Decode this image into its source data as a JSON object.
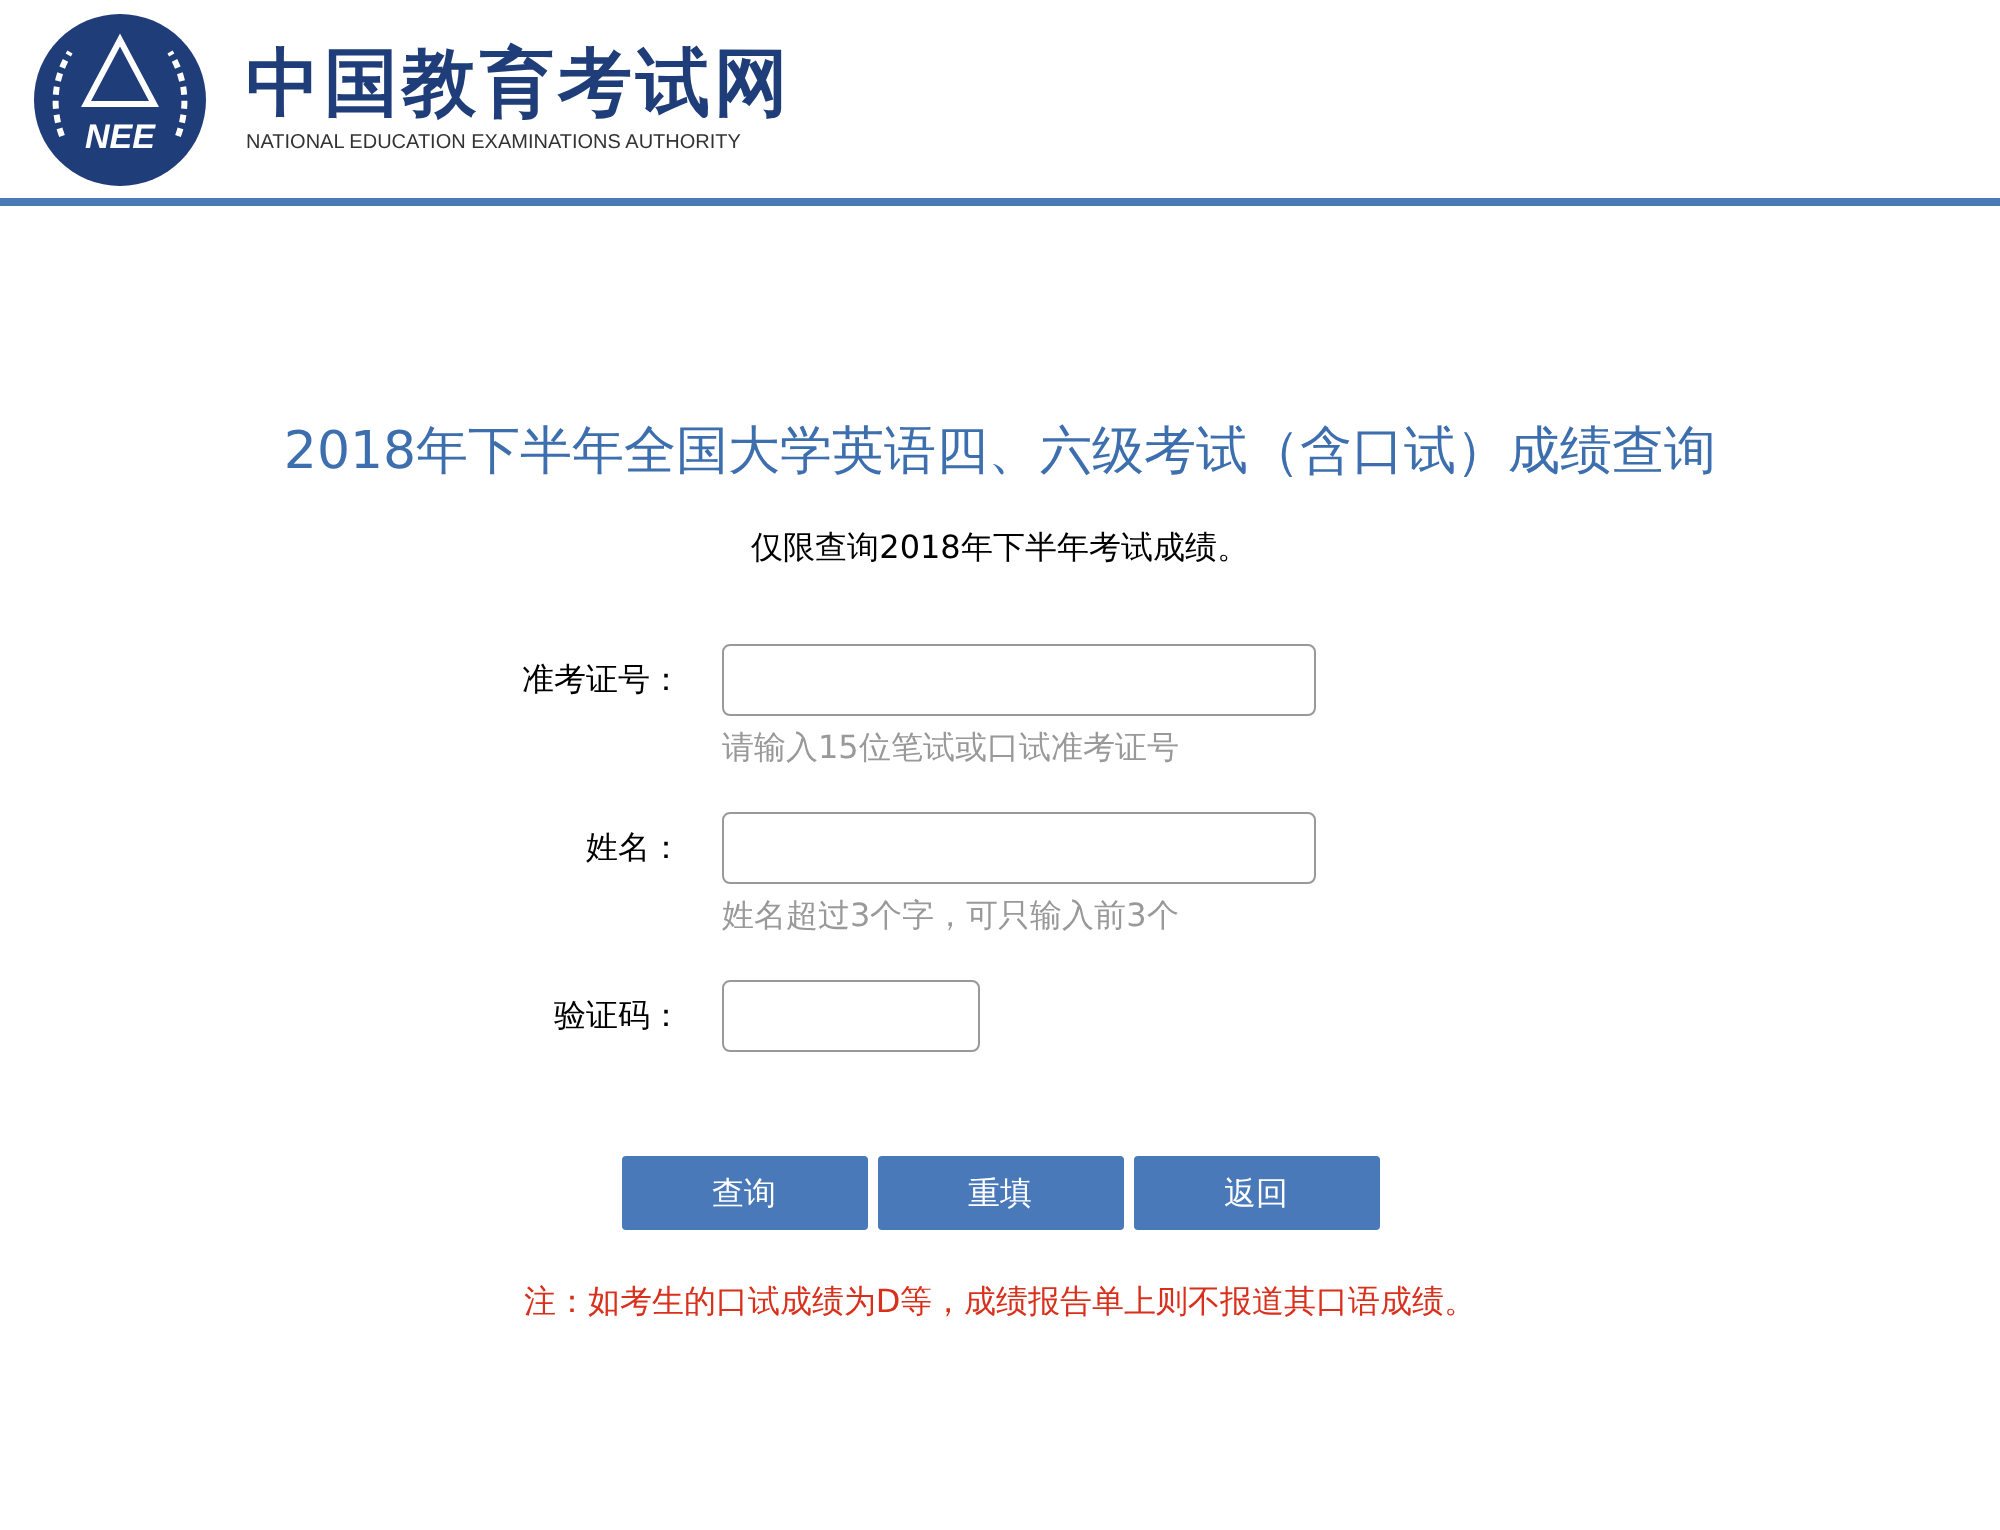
{
  "header": {
    "logo": {
      "emblem_text": "NEE",
      "name_cn": "中国教育考试网",
      "name_en": "NATIONAL EDUCATION EXAMINATIONS AUTHORITY"
    }
  },
  "title": "2018年下半年全国大学英语四、六级考试（含口试）成绩查询",
  "subtitle": "仅限查询2018年下半年考试成绩。",
  "fields": [
    {
      "label": "准考证号：",
      "kind": "wide",
      "hint": "请输入15位笔试或口试准考证号"
    },
    {
      "label": "姓名：",
      "kind": "wide",
      "hint": "姓名超过3个字，可只输入前3个"
    },
    {
      "label": "验证码：",
      "kind": "short"
    }
  ],
  "buttons": [
    "查询",
    "重填",
    "返回"
  ],
  "note": "注：如考生的口试成绩为D等，成绩报告单上则不报道其口语成绩。"
}
